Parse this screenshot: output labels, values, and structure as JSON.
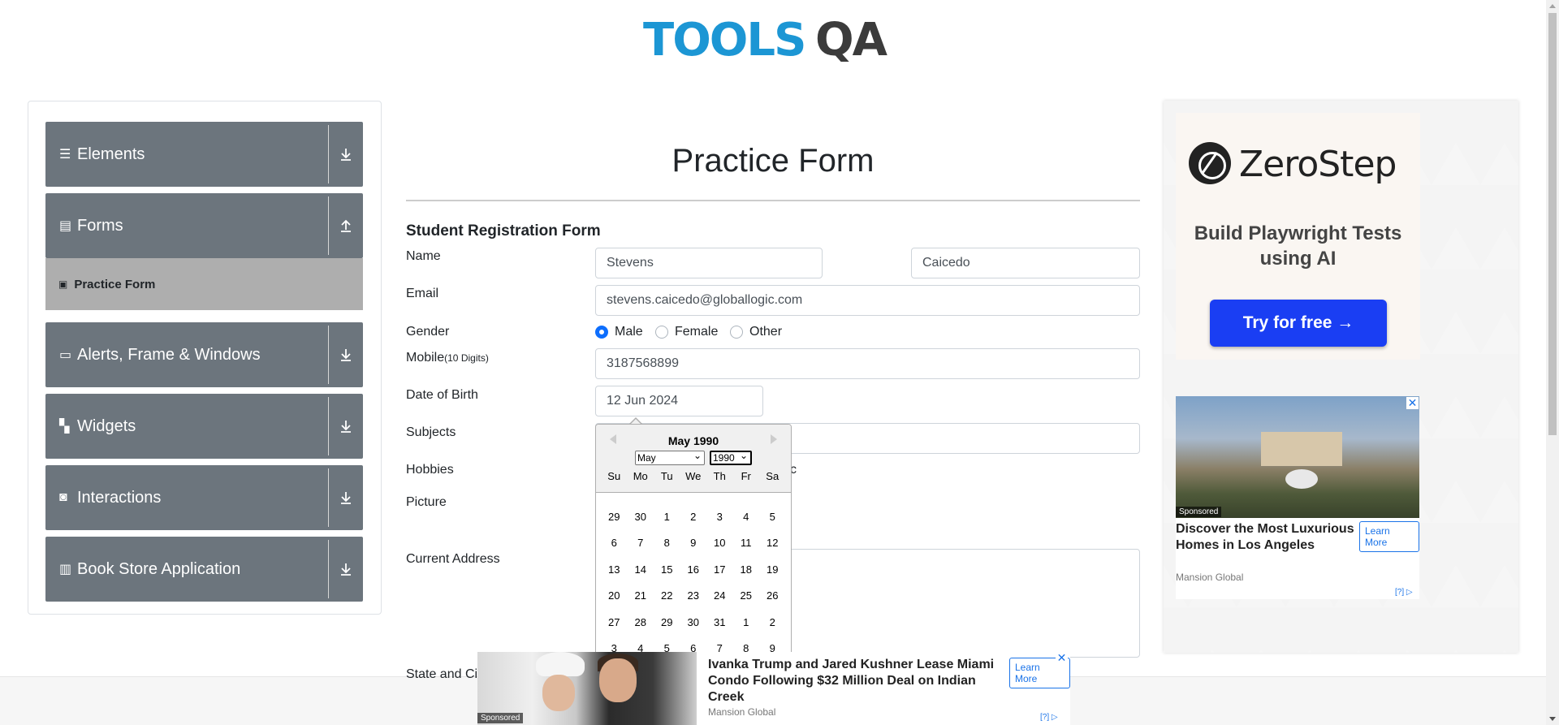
{
  "logo": {
    "part1": "TOOLS",
    "part2": "QA"
  },
  "sidebar": {
    "groups": [
      {
        "label": "Elements",
        "icon": "menu-icon"
      },
      {
        "label": "Forms",
        "icon": "document-icon"
      },
      {
        "label": "Alerts, Frame & Windows",
        "icon": "window-icon"
      },
      {
        "label": "Widgets",
        "icon": "widgets-icon"
      },
      {
        "label": "Interactions",
        "icon": "interactions-icon"
      },
      {
        "label": "Book Store Application",
        "icon": "book-icon"
      }
    ],
    "active_item": "Practice Form"
  },
  "page": {
    "title": "Practice Form",
    "form_title": "Student Registration Form"
  },
  "form": {
    "name_label": "Name",
    "first_name": "Stevens",
    "last_name": "Caicedo",
    "email_label": "Email",
    "email": "stevens.caicedo@globallogic.com",
    "gender_label": "Gender",
    "gender_options": [
      "Male",
      "Female",
      "Other"
    ],
    "gender_selected": "Male",
    "mobile_label": "Mobile",
    "mobile_hint": "(10 Digits)",
    "mobile": "3187568899",
    "dob_label": "Date of Birth",
    "dob": "12 Jun 2024",
    "subjects_label": "Subjects",
    "hobbies_label": "Hobbies",
    "hobbies_partial": "c",
    "picture_label": "Picture",
    "address_label": "Current Address",
    "state_label": "State and Cit"
  },
  "datepicker": {
    "header": "May 1990",
    "month_select": "May",
    "year_select": "1990",
    "weekdays": [
      "Su",
      "Mo",
      "Tu",
      "We",
      "Th",
      "Fr",
      "Sa"
    ],
    "weeks": [
      [
        "29",
        "30",
        "1",
        "2",
        "3",
        "4",
        "5"
      ],
      [
        "6",
        "7",
        "8",
        "9",
        "10",
        "11",
        "12"
      ],
      [
        "13",
        "14",
        "15",
        "16",
        "17",
        "18",
        "19"
      ],
      [
        "20",
        "21",
        "22",
        "23",
        "24",
        "25",
        "26"
      ],
      [
        "27",
        "28",
        "29",
        "30",
        "31",
        "1",
        "2"
      ],
      [
        "3",
        "4",
        "5",
        "6",
        "7",
        "8",
        "9"
      ]
    ]
  },
  "ads": {
    "zerostep": {
      "brand": "ZeroStep",
      "tagline": "Build Playwright Tests using AI",
      "button": "Try for free →"
    },
    "mansion": {
      "sponsored": "Sponsored",
      "title": "Discover the Most Luxurious Homes in Los Angeles",
      "source": "Mansion Global",
      "learn_more": "Learn More",
      "adchoice": "[?]"
    },
    "bottom": {
      "sponsored": "Sponsored",
      "title": "Ivanka Trump and Jared Kushner Lease Miami Condo Following $32 Million Deal on Indian Creek",
      "source": "Mansion Global",
      "learn_more": "Learn More",
      "adchoice": "[?]"
    }
  },
  "colors": {
    "logo_blue": "#1c96d4",
    "sidebar_header": "#6c757d",
    "active_item": "#aeaeae",
    "radio_checked": "#0d6efd",
    "zerostep_button": "#1a3ef3"
  }
}
